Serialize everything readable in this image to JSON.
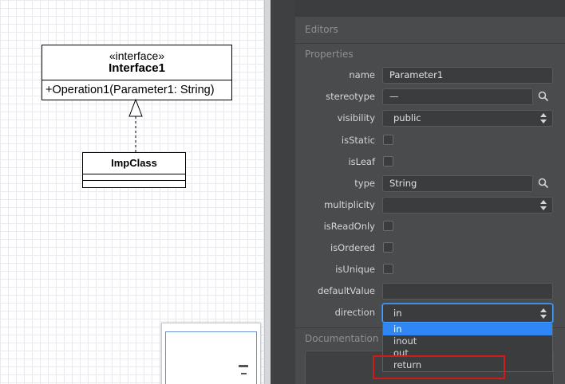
{
  "diagram": {
    "interface": {
      "stereotype": "«interface»",
      "name": "Interface1",
      "operation": "+Operation1(Parameter1: String)"
    },
    "impl_class": {
      "name": "ImpClass"
    }
  },
  "panel": {
    "editors_title": "Editors",
    "properties_title": "Properties",
    "documentation_title": "Documentation",
    "fields": {
      "name": {
        "label": "name",
        "value": "Parameter1"
      },
      "stereotype": {
        "label": "stereotype",
        "value": "—"
      },
      "visibility": {
        "label": "visibility",
        "value": "public"
      },
      "isStatic": {
        "label": "isStatic"
      },
      "isLeaf": {
        "label": "isLeaf"
      },
      "type": {
        "label": "type",
        "value": "String"
      },
      "multiplicity": {
        "label": "multiplicity",
        "value": ""
      },
      "isReadOnly": {
        "label": "isReadOnly"
      },
      "isOrdered": {
        "label": "isOrdered"
      },
      "isUnique": {
        "label": "isUnique"
      },
      "defaultValue": {
        "label": "defaultValue",
        "value": ""
      },
      "direction": {
        "label": "direction",
        "value": "in"
      }
    },
    "direction_options": [
      "in",
      "inout",
      "out",
      "return"
    ]
  },
  "colors": {
    "panel_bg": "#4a4b4c",
    "selection": "#2f86f5",
    "focus": "#4aa3ff",
    "annotation": "#d11a1a"
  }
}
